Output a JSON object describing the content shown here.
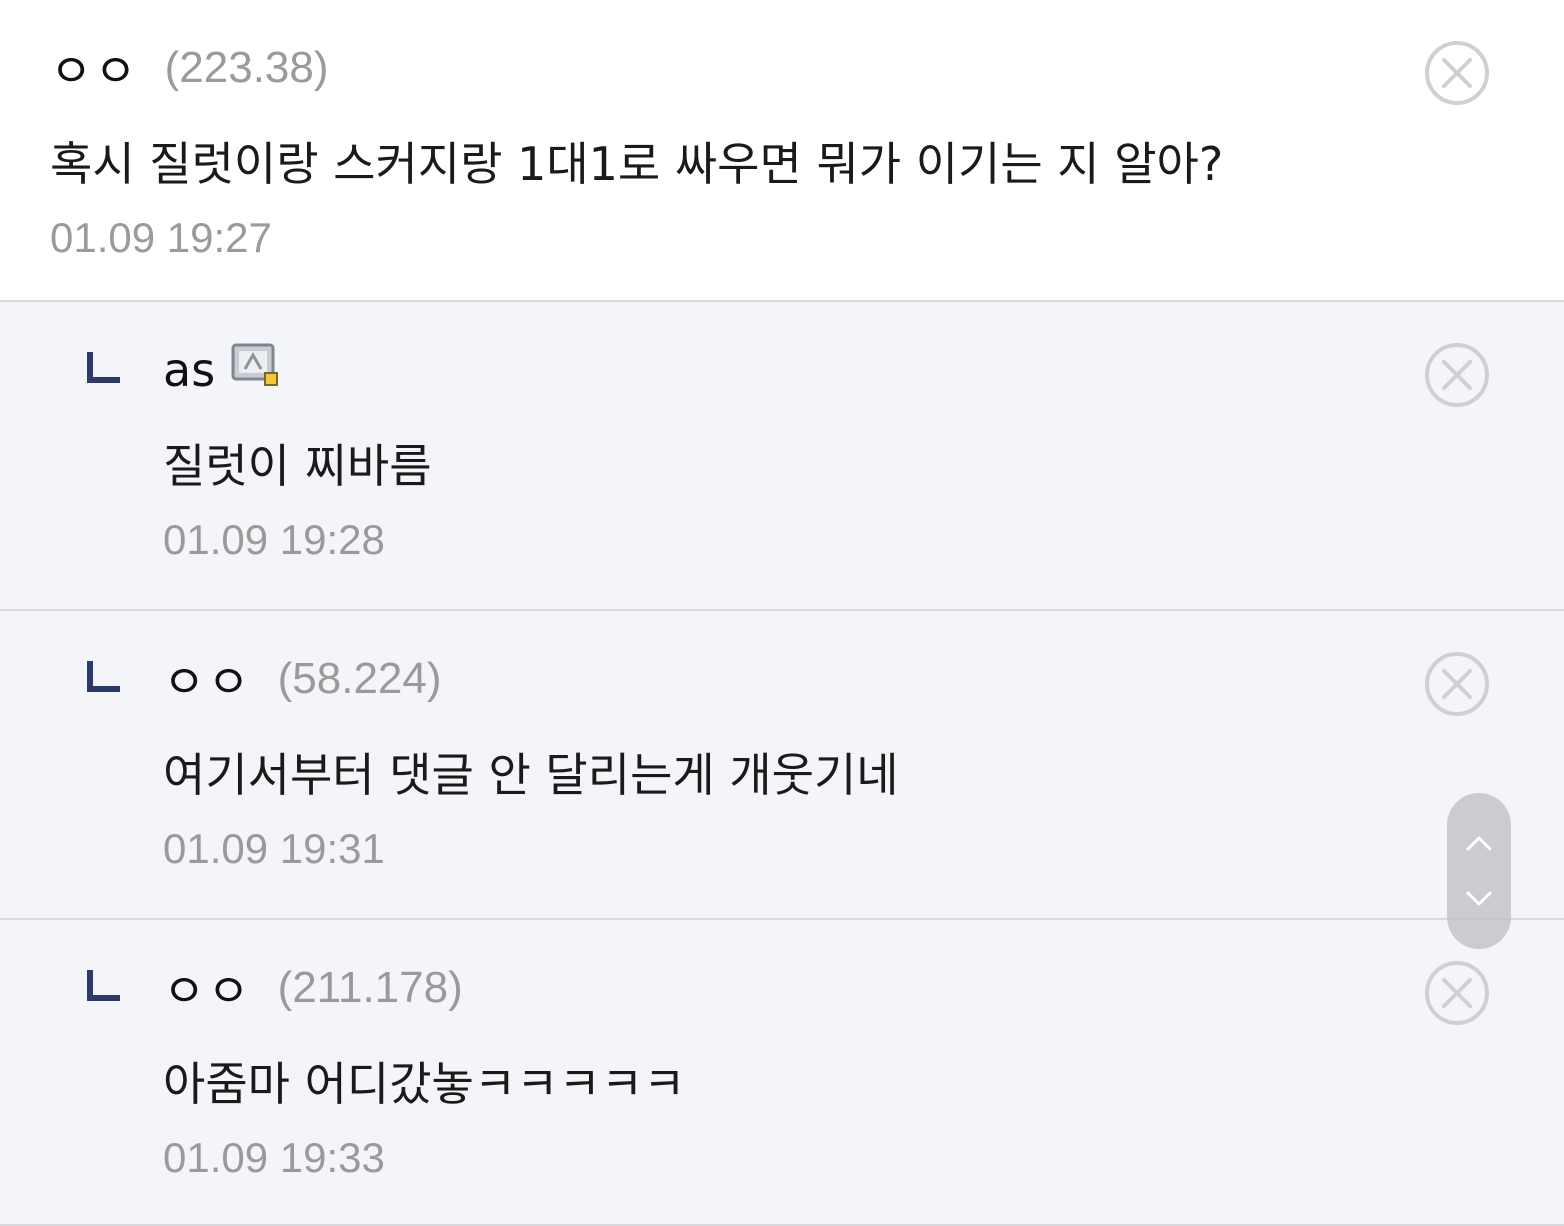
{
  "comments": [
    {
      "nickname": "ㅇㅇ",
      "ip": "(223.38)",
      "text": "혹시 질럿이랑 스커지랑 1대1로 싸우면 뭐가 이기는 지 알아?",
      "time": "01.09 19:27",
      "is_reply": false
    },
    {
      "nickname": "as",
      "badge_icon": "member-badge-icon",
      "text": "질럿이 찌바름",
      "time": "01.09 19:28",
      "is_reply": true
    },
    {
      "nickname": "ㅇㅇ",
      "ip": "(58.224)",
      "text": "여기서부터 댓글 안 달리는게 개웃기네",
      "time": "01.09 19:31",
      "is_reply": true
    },
    {
      "nickname": "ㅇㅇ",
      "ip": "(211.178)",
      "text": "아줌마 어디갔놓ㅋㅋㅋㅋㅋ",
      "time": "01.09 19:33",
      "is_reply": true
    }
  ],
  "icons": {
    "delete": "close-circle-icon",
    "reply_marker": "reply-arrow-icon",
    "scroll_up": "chevron-up-icon",
    "scroll_down": "chevron-down-icon"
  },
  "colors": {
    "reply_background": "#f4f5f8",
    "reply_marker": "#2b3a67",
    "meta_text": "#9a9a9a",
    "divider": "#d9d9de"
  }
}
